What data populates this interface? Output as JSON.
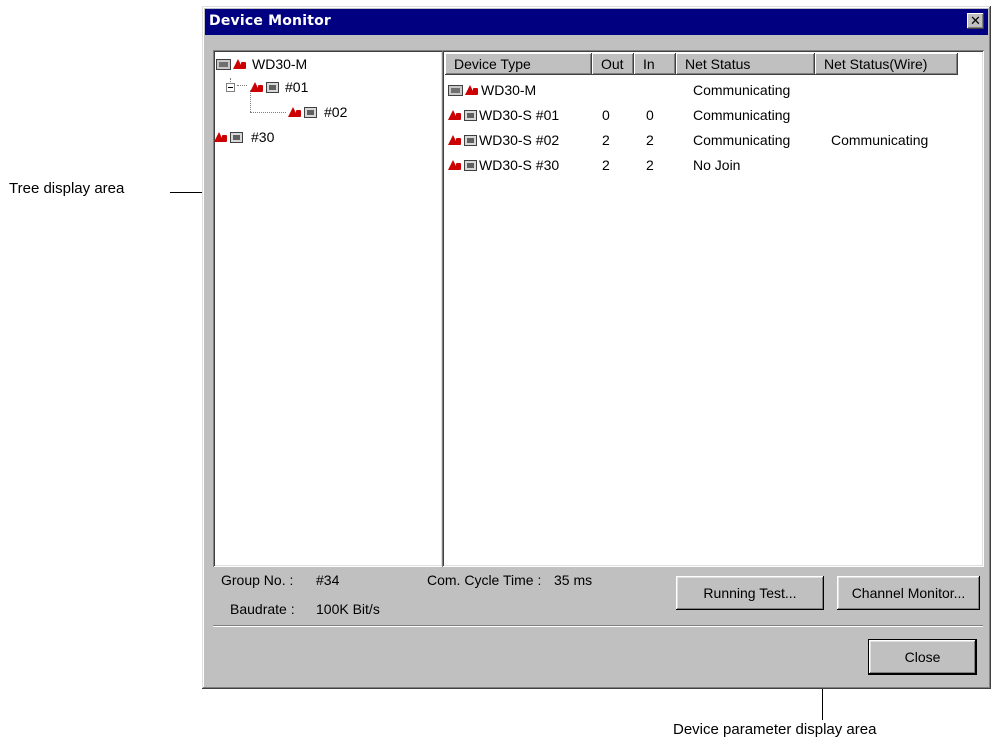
{
  "window": {
    "title": "Device Monitor",
    "close_glyph": "✕"
  },
  "tree": {
    "nodes": [
      {
        "label": "WD30-M",
        "icon": "master-device-icon"
      },
      {
        "label": "#01",
        "icon": "slave-device-icon"
      },
      {
        "label": "#02",
        "icon": "slave-device-icon"
      },
      {
        "label": "#30",
        "icon": "slave-device-icon"
      }
    ]
  },
  "list": {
    "columns": [
      "Device Type",
      "Out",
      "In",
      "Net Status",
      "Net Status(Wire)"
    ],
    "rows": [
      {
        "device_type": "WD30-M",
        "out": "",
        "in": "",
        "net_status": "Communicating",
        "net_status_wire": "",
        "icon": "master-device-icon"
      },
      {
        "device_type": "WD30-S #01",
        "out": "0",
        "in": "0",
        "net_status": "Communicating",
        "net_status_wire": "",
        "icon": "slave-device-icon"
      },
      {
        "device_type": "WD30-S #02",
        "out": "2",
        "in": "2",
        "net_status": "Communicating",
        "net_status_wire": "Communicating",
        "icon": "slave-device-icon"
      },
      {
        "device_type": "WD30-S #30",
        "out": "2",
        "in": "2",
        "net_status": "No Join",
        "net_status_wire": "",
        "icon": "slave-device-icon"
      }
    ]
  },
  "info": {
    "group_label": "Group No. :",
    "group_value": "#34",
    "baud_label": "Baudrate :",
    "baud_value": "100K Bit/s",
    "cycle_label": "Com. Cycle Time :",
    "cycle_value": "35 ms"
  },
  "buttons": {
    "running_test": "Running Test...",
    "channel_monitor": "Channel Monitor...",
    "close": "Close"
  },
  "annotations": {
    "tree_area": "Tree display area",
    "param_area": "Device parameter display area"
  },
  "colors": {
    "title_bar": "#000080",
    "dialog_face": "#c0c0c0",
    "status_icon_red": "#cc0000"
  }
}
